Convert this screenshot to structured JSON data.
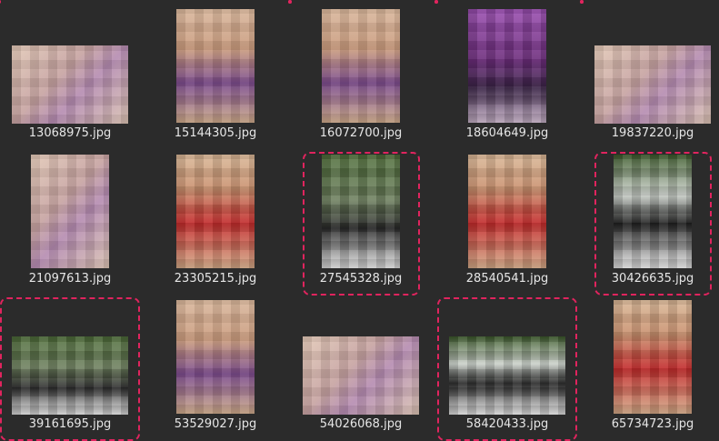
{
  "colors": {
    "background": "#2b2b2b",
    "selection": "#e0245e",
    "label": "#e6e6e6"
  },
  "files": [
    {
      "name": "13068975.jpg",
      "selected": false,
      "palette": "light"
    },
    {
      "name": "15144305.jpg",
      "selected": false,
      "palette": "skin"
    },
    {
      "name": "16072700.jpg",
      "selected": false,
      "palette": "skin"
    },
    {
      "name": "18604649.jpg",
      "selected": false,
      "palette": "purple"
    },
    {
      "name": "19837220.jpg",
      "selected": false,
      "palette": "light"
    },
    {
      "name": "21097613.jpg",
      "selected": false,
      "palette": "light"
    },
    {
      "name": "23305215.jpg",
      "selected": false,
      "palette": "red"
    },
    {
      "name": "27545328.jpg",
      "selected": true,
      "palette": "green"
    },
    {
      "name": "28540541.jpg",
      "selected": false,
      "palette": "red"
    },
    {
      "name": "30426635.jpg",
      "selected": true,
      "palette": "bw"
    },
    {
      "name": "39161695.jpg",
      "selected": true,
      "palette": "green"
    },
    {
      "name": "53529027.jpg",
      "selected": false,
      "palette": "skin"
    },
    {
      "name": "54026068.jpg",
      "selected": false,
      "palette": "light"
    },
    {
      "name": "58420433.jpg",
      "selected": true,
      "palette": "bw"
    },
    {
      "name": "65734723.jpg",
      "selected": false,
      "palette": "red"
    }
  ]
}
